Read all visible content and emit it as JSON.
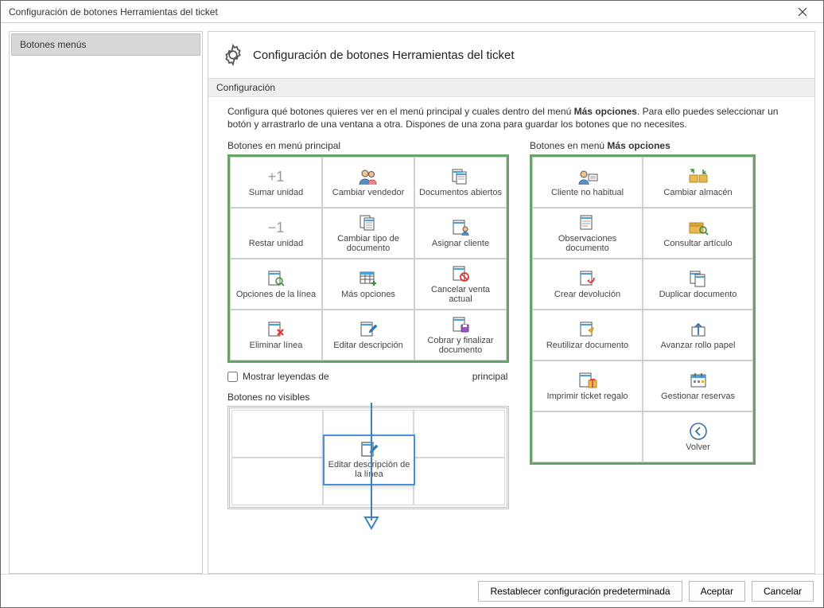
{
  "window": {
    "title": "Configuración de botones Herramientas del ticket"
  },
  "sidebar": {
    "items": [
      {
        "label": "Botones menús"
      }
    ]
  },
  "header": {
    "title": "Configuración de botones Herramientas del ticket"
  },
  "section_label": "Configuración",
  "description_part1": "Configura qué botones quieres ver en el menú principal y cuales dentro del menú ",
  "description_bold": "Más opciones",
  "description_part2": ". Para ello puedes seleccionar un botón y arrastrarlo de una ventana a otra. Dispones de una zona para guardar los botones que no necesites.",
  "group_main_label": "Botones en menú principal",
  "group_more_label_prefix": "Botones en menú ",
  "group_more_label_bold": "Más opciones",
  "hidden_label": "Botones no visibles",
  "checkbox_label_part1": "Mostrar leyendas de",
  "checkbox_label_part2": "principal",
  "main_buttons": [
    {
      "label": "Sumar unidad",
      "icon": "plus1"
    },
    {
      "label": "Cambiar vendedor",
      "icon": "people"
    },
    {
      "label": "Documentos abiertos",
      "icon": "docs-open"
    },
    {
      "label": "Restar unidad",
      "icon": "minus1"
    },
    {
      "label": "Cambiar tipo de documento",
      "icon": "doc-type"
    },
    {
      "label": "Asignar cliente",
      "icon": "doc-person"
    },
    {
      "label": "Opciones de la línea",
      "icon": "doc-search"
    },
    {
      "label": "Más opciones",
      "icon": "table-plus"
    },
    {
      "label": "Cancelar venta actual",
      "icon": "doc-forbid"
    },
    {
      "label": "Eliminar línea",
      "icon": "doc-x"
    },
    {
      "label": "Editar descripción",
      "icon": "doc-edit"
    },
    {
      "label": "Cobrar y finalizar documento",
      "icon": "doc-save"
    }
  ],
  "more_buttons": [
    {
      "label": "Cliente no habitual",
      "icon": "person-card"
    },
    {
      "label": "Cambiar almacén",
      "icon": "warehouse-swap"
    },
    {
      "label": "Observaciones documento",
      "icon": "doc-note"
    },
    {
      "label": "Consultar artículo",
      "icon": "box-search"
    },
    {
      "label": "Crear devolución",
      "icon": "doc-return"
    },
    {
      "label": "Duplicar documento",
      "icon": "doc-dup"
    },
    {
      "label": "Reutilizar documento",
      "icon": "doc-reuse"
    },
    {
      "label": "Avanzar rollo papel",
      "icon": "roll-up"
    },
    {
      "label": "Imprimir ticket regalo",
      "icon": "doc-gift"
    },
    {
      "label": "Gestionar reservas",
      "icon": "calendar"
    },
    {
      "label": "",
      "icon": "blank"
    },
    {
      "label": "Volver",
      "icon": "back"
    }
  ],
  "drag_ghost": {
    "label": "Editar descripción de la línea"
  },
  "footer": {
    "reset": "Restablecer configuración predeterminada",
    "ok": "Aceptar",
    "cancel": "Cancelar"
  }
}
